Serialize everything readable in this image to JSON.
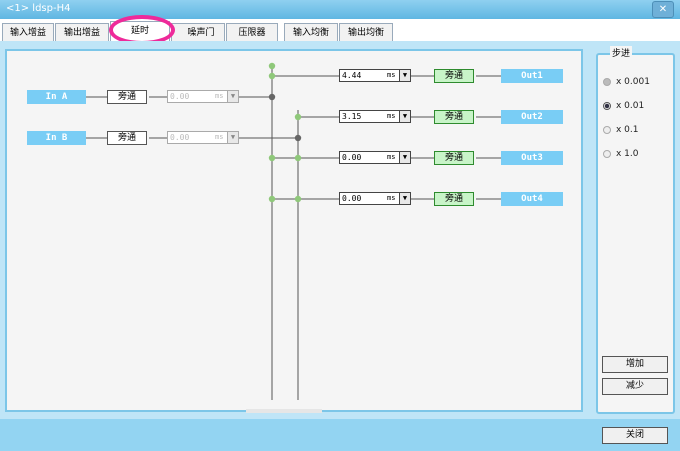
{
  "window": {
    "title": "<1> ldsp-H4",
    "close_label": "✕"
  },
  "tabs": [
    {
      "label": "输入增益"
    },
    {
      "label": "输出增益"
    },
    {
      "label": "延时"
    },
    {
      "label": "噪声门"
    },
    {
      "label": "压限器"
    },
    {
      "label": "输入均衡"
    },
    {
      "label": "输出均衡"
    }
  ],
  "inputs": [
    {
      "name": "In A",
      "bypass": "旁通",
      "delay": "0.00",
      "unit": "ms"
    },
    {
      "name": "In B",
      "bypass": "旁通",
      "delay": "0.00",
      "unit": "ms"
    }
  ],
  "outputs": [
    {
      "name": "Out1",
      "bypass": "旁通",
      "delay": "4.44",
      "unit": "ms"
    },
    {
      "name": "Out2",
      "bypass": "旁通",
      "delay": "3.15",
      "unit": "ms"
    },
    {
      "name": "Out3",
      "bypass": "旁通",
      "delay": "0.00",
      "unit": "ms"
    },
    {
      "name": "Out4",
      "bypass": "旁通",
      "delay": "0.00",
      "unit": "ms"
    }
  ],
  "step": {
    "legend": "步进",
    "options": [
      "x 0.001",
      "x 0.01",
      "x 0.1",
      "x 1.0"
    ],
    "selected": "x 0.01",
    "increase": "增加",
    "decrease": "减少"
  },
  "footer": {
    "close_label": "关闭"
  },
  "colors": {
    "accent": "#79cdf5",
    "highlight": "#ee2a9a",
    "node_green": "#8fc87a",
    "node_gray": "#666666"
  }
}
